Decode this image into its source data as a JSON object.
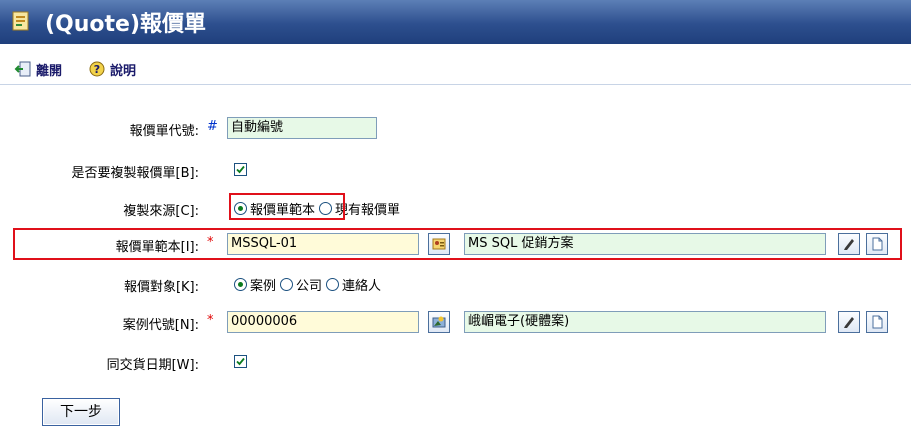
{
  "window": {
    "title": "(Quote)報價單"
  },
  "toolbar": {
    "leave_label": "離開",
    "help_label": "說明"
  },
  "form": {
    "quote_no": {
      "label": "報價單代號:",
      "mark": "#",
      "value": "自動編號"
    },
    "copy_quote": {
      "label": "是否要複製報價單[B]:",
      "checked": true
    },
    "copy_source": {
      "label": "複製來源[C]:",
      "options": [
        "報價單範本",
        "現有報價單"
      ],
      "selected": "報價單範本"
    },
    "template": {
      "label": "報價單範本[I]:",
      "mark": "*",
      "code": "MSSQL-01",
      "name": "MS SQL 促銷方案"
    },
    "target": {
      "label": "報價對象[K]:",
      "options": [
        "案例",
        "公司",
        "連絡人"
      ],
      "selected": "案例"
    },
    "case_no": {
      "label": "案例代號[N]:",
      "mark": "*",
      "code": "00000006",
      "name": "峨嵋電子(硬體案)"
    },
    "same_delivery": {
      "label": "同交貨日期[W]:",
      "checked": true
    }
  },
  "actions": {
    "next_label": "下一步"
  },
  "colors": {
    "title_bar": "#2d4f8e",
    "highlight_border": "#e0101a",
    "green_input": "#e7f9e7",
    "yellow_input": "#fffbd9"
  }
}
